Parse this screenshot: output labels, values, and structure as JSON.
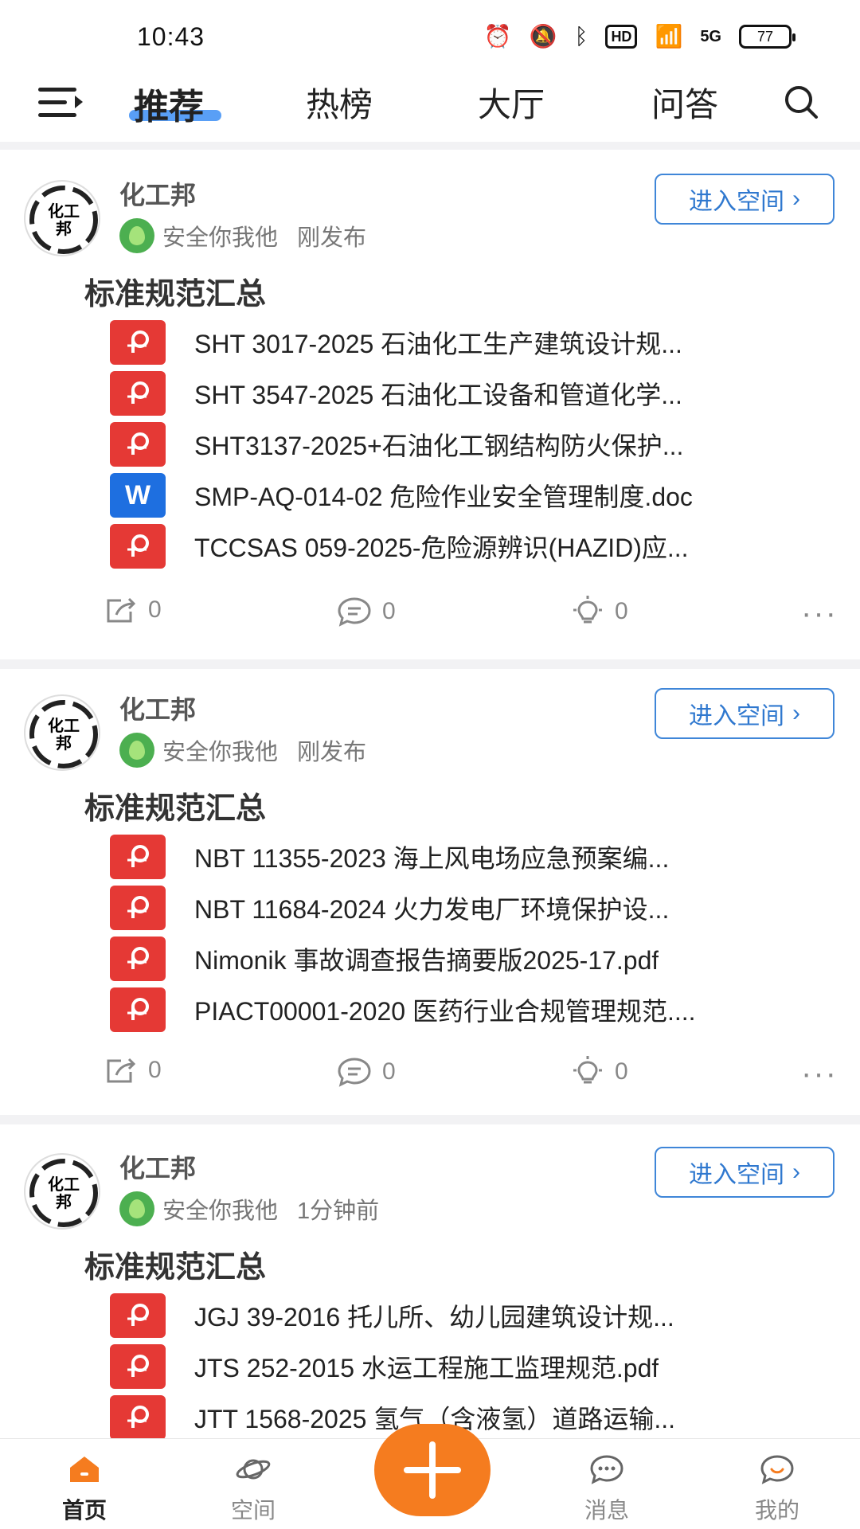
{
  "status_bar": {
    "time": "10:43",
    "network": "5G",
    "hd": "HD",
    "battery": "77"
  },
  "top_nav": {
    "tabs": [
      {
        "label": "推荐",
        "active": true
      },
      {
        "label": "热榜",
        "active": false
      },
      {
        "label": "大厅",
        "active": false
      },
      {
        "label": "问答",
        "active": false
      }
    ],
    "menu_icon": "menu-icon",
    "search_icon": "search-icon"
  },
  "posts": [
    {
      "author": "化工邦",
      "space": "安全你我他",
      "time": "刚发布",
      "enter_label": "进入空间",
      "title": "标准规范汇总",
      "files": [
        {
          "type": "pdf",
          "name": "SHT 3017-2025 石油化工生产建筑设计规..."
        },
        {
          "type": "pdf",
          "name": "SHT 3547-2025 石油化工设备和管道化学..."
        },
        {
          "type": "pdf",
          "name": "SHT3137-2025+石油化工钢结构防火保护..."
        },
        {
          "type": "word",
          "name": "SMP-AQ-014-02 危险作业安全管理制度.doc",
          "icon_letter": "W"
        },
        {
          "type": "pdf",
          "name": "TCCSAS 059-2025-危险源辨识(HAZID)应..."
        }
      ],
      "shares": "0",
      "comments": "0",
      "likes": "0"
    },
    {
      "author": "化工邦",
      "space": "安全你我他",
      "time": "刚发布",
      "enter_label": "进入空间",
      "title": "标准规范汇总",
      "files": [
        {
          "type": "pdf",
          "name": "NBT 11355-2023 海上风电场应急预案编..."
        },
        {
          "type": "pdf",
          "name": "NBT 11684-2024 火力发电厂环境保护设..."
        },
        {
          "type": "pdf",
          "name": "Nimonik 事故调查报告摘要版2025-17.pdf"
        },
        {
          "type": "pdf",
          "name": "PIACT00001-2020 医药行业合规管理规范...."
        }
      ],
      "shares": "0",
      "comments": "0",
      "likes": "0"
    },
    {
      "author": "化工邦",
      "space": "安全你我他",
      "time": "1分钟前",
      "enter_label": "进入空间",
      "title": "标准规范汇总",
      "files": [
        {
          "type": "pdf",
          "name": "JGJ 39-2016 托儿所、幼儿园建筑设计规..."
        },
        {
          "type": "pdf",
          "name": "JTS 252-2015 水运工程施工监理规范.pdf"
        },
        {
          "type": "pdf",
          "name": "JTT 1568-2025 氢气（含液氢）道路运输..."
        }
      ]
    }
  ],
  "bottom_nav": {
    "items": [
      {
        "label": "首页",
        "icon": "home-icon",
        "active": true
      },
      {
        "label": "空间",
        "icon": "planet-icon",
        "active": false
      },
      {
        "label": "消息",
        "icon": "message-icon",
        "active": false
      },
      {
        "label": "我的",
        "icon": "profile-icon",
        "active": false
      }
    ],
    "fab_icon": "plus-icon"
  },
  "colors": {
    "accent": "#3c8ef5",
    "fab": "#f57c1f",
    "pdf": "#e53935",
    "word": "#1e6fe0"
  }
}
